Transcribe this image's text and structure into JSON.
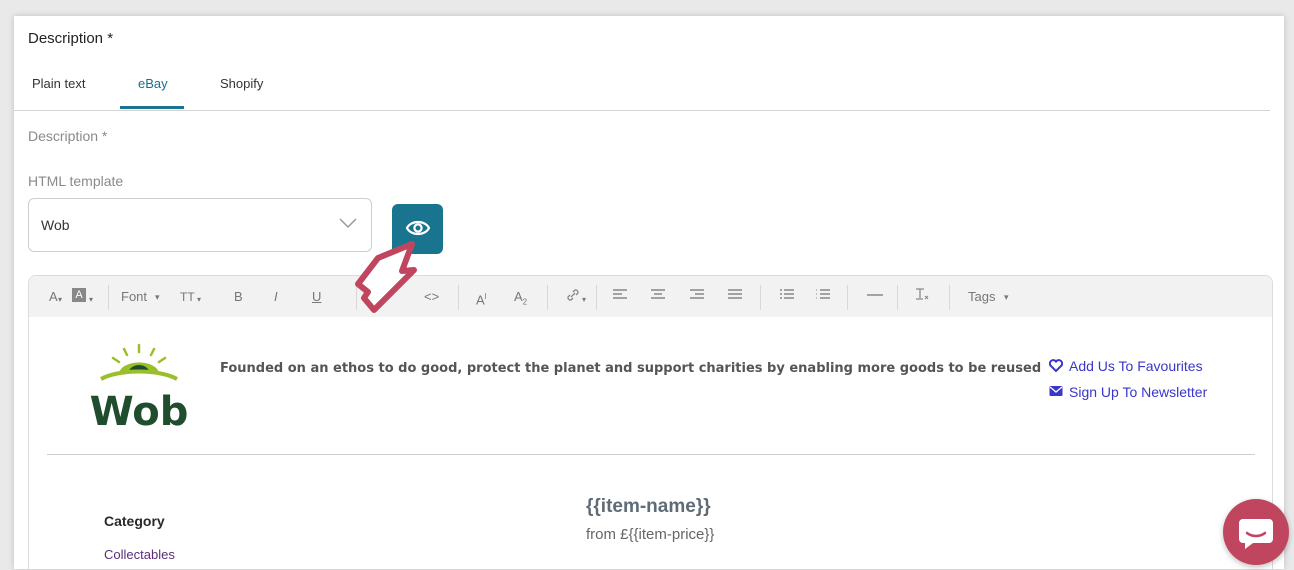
{
  "section": {
    "title": "Description *"
  },
  "tabs": [
    {
      "label": "Plain text"
    },
    {
      "label": "eBay"
    },
    {
      "label": "Shopify"
    }
  ],
  "active_tab": "eBay",
  "description_label": "Description *",
  "html_template": {
    "label": "HTML template",
    "selected": "Wob"
  },
  "toolbar": {
    "font_color": "A",
    "background_color": "A",
    "font": "Font",
    "font_size": "TT",
    "bold": "B",
    "italic": "I",
    "underline": "U",
    "code_view": "<>",
    "superscript": "A",
    "subscript": "A",
    "tags": "Tags"
  },
  "template_content": {
    "logo_text": "Wob",
    "tagline": "Founded on an ethos to do good, protect the planet and support charities by enabling more goods to be reused",
    "links": [
      {
        "label": "Add Us To Favourites",
        "icon": "heart-icon"
      },
      {
        "label": "Sign Up To Newsletter",
        "icon": "envelope-icon"
      }
    ],
    "category_label": "Category",
    "category_value": "Collectables",
    "item_name": "{{item-name}}",
    "item_price": "from £{{item-price}}"
  },
  "colors": {
    "accent": "#19758f",
    "chat": "#c0465f",
    "cursor": "#c0465f",
    "link": "#3a36c9"
  }
}
